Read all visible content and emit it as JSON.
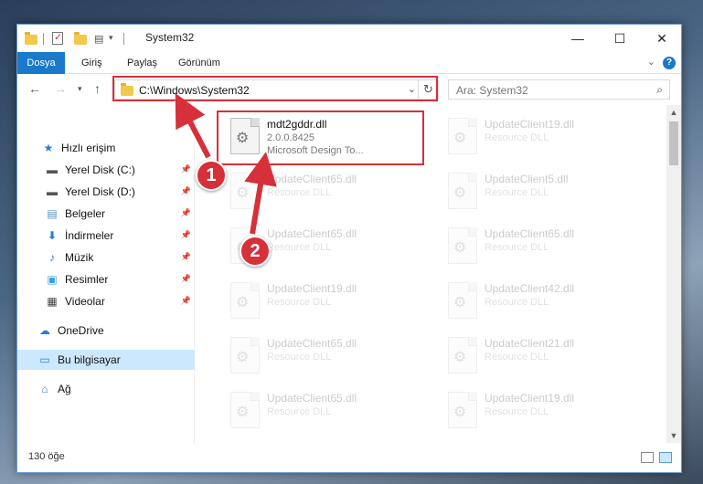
{
  "window": {
    "title": "System32"
  },
  "ribbon": {
    "tabs": [
      "Dosya",
      "Giriş",
      "Paylaş",
      "Görünüm"
    ]
  },
  "address": {
    "path": "C:\\Windows\\System32",
    "search_placeholder": "Ara: System32"
  },
  "sidebar": {
    "items": [
      {
        "label": "Hızlı erişim"
      },
      {
        "label": "Yerel Disk (C:)"
      },
      {
        "label": "Yerel Disk (D:)"
      },
      {
        "label": "Belgeler"
      },
      {
        "label": "İndirmeler"
      },
      {
        "label": "Müzik"
      },
      {
        "label": "Resimler"
      },
      {
        "label": "Videolar"
      },
      {
        "label": "OneDrive"
      },
      {
        "label": "Bu bilgisayar"
      },
      {
        "label": "Ağ"
      }
    ]
  },
  "files": {
    "highlighted": {
      "name": "mdt2gddr.dll",
      "version": "2.0.0.8425",
      "description": "Microsoft Design To..."
    },
    "left": [
      {
        "name": "UpdateClient65.dll",
        "desc": "Resource DLL"
      },
      {
        "name": "UpdateClient65.dll",
        "desc": "Resource DLL"
      },
      {
        "name": "UpdateClient19.dll",
        "desc": "Resource DLL"
      },
      {
        "name": "UpdateClient65.dll",
        "desc": "Resource DLL"
      },
      {
        "name": "UpdateClient65.dll",
        "desc": "Resource DLL"
      }
    ],
    "right": [
      {
        "name": "UpdateClient19.dll",
        "desc": "Resource DLL"
      },
      {
        "name": "UpdateClient5.dll",
        "desc": "Resource DLL"
      },
      {
        "name": "UpdateClient65.dll",
        "desc": "Resource DLL"
      },
      {
        "name": "UpdateClient42.dll",
        "desc": "Resource DLL"
      },
      {
        "name": "UpdateClient21.dll",
        "desc": "Resource DLL"
      },
      {
        "name": "UpdateClient19.dll",
        "desc": "Resource DLL"
      }
    ]
  },
  "status": {
    "count": "130 öğe"
  },
  "callouts": {
    "one": "1",
    "two": "2"
  },
  "colors": {
    "accent": "#1979ca",
    "highlight_red": "#d6303a",
    "selection": "#cce8ff"
  }
}
